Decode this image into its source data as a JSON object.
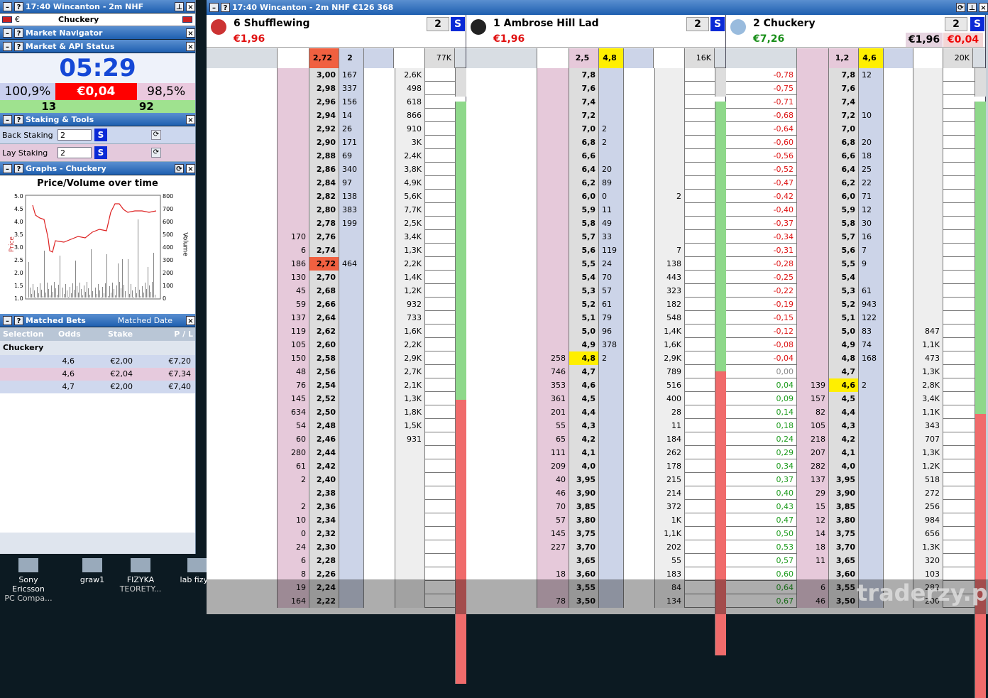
{
  "left": {
    "header": {
      "title": "17:40  Wincanton - 2m NHF",
      "currency": "€",
      "selection": "Chuckery"
    },
    "navigator": {
      "title": "Market Navigator"
    },
    "status": {
      "title": "Market & API Status",
      "clock": "05:29",
      "back_pct": "100,9%",
      "spread": "€0,04",
      "lay_pct": "98,5%",
      "count_left": "13",
      "count_right": "92"
    },
    "staking": {
      "title": "Staking & Tools",
      "back_label": "Back Staking",
      "back_value": "2",
      "lay_label": "Lay Staking",
      "lay_value": "2",
      "s": "S"
    },
    "graphs": {
      "title": "Graphs - Chuckery",
      "chart_title": "Price/Volume over time",
      "ylabel": "Price",
      "y2label": "Volume",
      "yticks": [
        "5.0",
        "4.5",
        "4.0",
        "3.5",
        "3.0",
        "2.5",
        "2.0",
        "1.5",
        "1.0"
      ],
      "y2ticks": [
        "800",
        "700",
        "600",
        "500",
        "400",
        "300",
        "200",
        "100",
        "0"
      ]
    },
    "matched": {
      "title": "Matched Bets",
      "date_label": "Matched Date",
      "cols": [
        "Selection",
        "Odds",
        "Stake",
        "P / L"
      ],
      "selection": "Chuckery",
      "rows": [
        {
          "odds": "4,6",
          "stake": "€2,00",
          "pl": "€7,20"
        },
        {
          "odds": "4,6",
          "stake": "€2,04",
          "pl": "€7,34"
        },
        {
          "odds": "4,7",
          "stake": "€2,00",
          "pl": "€7,40"
        }
      ]
    }
  },
  "desktop": [
    {
      "label": "Sony Ericsson",
      "sub": "PC Compa..."
    },
    {
      "label": "graw1",
      "sub": ""
    },
    {
      "label": "FIZYKA",
      "sub": "TEORETY..."
    },
    {
      "label": "lab fizyki",
      "sub": ""
    }
  ],
  "top": {
    "title": "17:40  Wincanton - 2m NHF   €126 368"
  },
  "watermark": "traderzy.pl",
  "ladders": [
    {
      "name": "6 Shufflewing",
      "price": "€1,96",
      "stake": "2",
      "s": "S",
      "head": [
        "2,72",
        "2",
        "77K"
      ],
      "rows": [
        [
          "",
          "3,00",
          "167",
          "2,6K"
        ],
        [
          "",
          "2,98",
          "337",
          "498"
        ],
        [
          "",
          "2,96",
          "156",
          "618"
        ],
        [
          "",
          "2,94",
          "14",
          "866"
        ],
        [
          "",
          "2,92",
          "26",
          "910"
        ],
        [
          "",
          "2,90",
          "171",
          "3K"
        ],
        [
          "",
          "2,88",
          "69",
          "2,4K"
        ],
        [
          "",
          "2,86",
          "340",
          "3,8K"
        ],
        [
          "",
          "2,84",
          "97",
          "4,9K"
        ],
        [
          "",
          "2,82",
          "138",
          "5,6K"
        ],
        [
          "",
          "2,80",
          "383",
          "7,7K"
        ],
        [
          "",
          "2,78",
          "199",
          "2,5K"
        ],
        [
          "170",
          "2,76",
          "",
          "3,4K"
        ],
        [
          "6",
          "2,74",
          "",
          "1,3K"
        ],
        [
          "186",
          "2,72",
          "464",
          "2,2K"
        ],
        [
          "130",
          "2,70",
          "",
          "1,4K"
        ],
        [
          "45",
          "2,68",
          "",
          "1,2K"
        ],
        [
          "59",
          "2,66",
          "",
          "932"
        ],
        [
          "137",
          "2,64",
          "",
          "733"
        ],
        [
          "119",
          "2,62",
          "",
          "1,6K"
        ],
        [
          "105",
          "2,60",
          "",
          "2,2K"
        ],
        [
          "150",
          "2,58",
          "",
          "2,9K"
        ],
        [
          "48",
          "2,56",
          "",
          "2,7K"
        ],
        [
          "76",
          "2,54",
          "",
          "2,1K"
        ],
        [
          "145",
          "2,52",
          "",
          "1,3K"
        ],
        [
          "634",
          "2,50",
          "",
          "1,8K"
        ],
        [
          "54",
          "2,48",
          "",
          "1,5K"
        ],
        [
          "60",
          "2,46",
          "",
          "931"
        ],
        [
          "280",
          "2,44",
          "",
          ""
        ],
        [
          "61",
          "2,42",
          "",
          ""
        ],
        [
          "2",
          "2,40",
          "",
          ""
        ],
        [
          "",
          "2,38",
          "",
          ""
        ],
        [
          "2",
          "2,36",
          "",
          ""
        ],
        [
          "10",
          "2,34",
          "",
          ""
        ],
        [
          "0",
          "2,32",
          "",
          ""
        ],
        [
          "24",
          "2,30",
          "",
          ""
        ],
        [
          "6",
          "2,28",
          "",
          ""
        ],
        [
          "8",
          "2,26",
          "",
          ""
        ],
        [
          "19",
          "2,24",
          "",
          ""
        ],
        [
          "164",
          "2,22",
          "",
          ""
        ]
      ]
    },
    {
      "name": "1 Ambrose Hill Lad",
      "price": "€1,96",
      "stake": "2",
      "s": "S",
      "head": [
        "2,5",
        "4,8",
        "16K"
      ],
      "rows": [
        [
          "",
          "7,8",
          "",
          ""
        ],
        [
          "",
          "7,6",
          "",
          ""
        ],
        [
          "",
          "7,4",
          "",
          ""
        ],
        [
          "",
          "7,2",
          "",
          ""
        ],
        [
          "",
          "7,0",
          "2",
          ""
        ],
        [
          "",
          "6,8",
          "2",
          ""
        ],
        [
          "",
          "6,6",
          "",
          ""
        ],
        [
          "",
          "6,4",
          "20",
          ""
        ],
        [
          "",
          "6,2",
          "89",
          ""
        ],
        [
          "",
          "6,0",
          "0",
          "2"
        ],
        [
          "",
          "5,9",
          "11",
          ""
        ],
        [
          "",
          "5,8",
          "49",
          ""
        ],
        [
          "",
          "5,7",
          "33",
          ""
        ],
        [
          "",
          "5,6",
          "119",
          "7"
        ],
        [
          "",
          "5,5",
          "24",
          "138"
        ],
        [
          "",
          "5,4",
          "70",
          "443"
        ],
        [
          "",
          "5,3",
          "57",
          "323"
        ],
        [
          "",
          "5,2",
          "61",
          "182"
        ],
        [
          "",
          "5,1",
          "79",
          "548"
        ],
        [
          "",
          "5,0",
          "96",
          "1,4K"
        ],
        [
          "",
          "4,9",
          "378",
          "1,6K"
        ],
        [
          "258",
          "4,8",
          "2",
          "2,9K"
        ],
        [
          "746",
          "4,7",
          "",
          "789"
        ],
        [
          "353",
          "4,6",
          "",
          "516"
        ],
        [
          "361",
          "4,5",
          "",
          "400"
        ],
        [
          "201",
          "4,4",
          "",
          "28"
        ],
        [
          "55",
          "4,3",
          "",
          "11"
        ],
        [
          "65",
          "4,2",
          "",
          "184"
        ],
        [
          "111",
          "4,1",
          "",
          "262"
        ],
        [
          "209",
          "4,0",
          "",
          "178"
        ],
        [
          "40",
          "3,95",
          "",
          "215"
        ],
        [
          "46",
          "3,90",
          "",
          "214"
        ],
        [
          "70",
          "3,85",
          "",
          "372"
        ],
        [
          "57",
          "3,80",
          "",
          "1K"
        ],
        [
          "145",
          "3,75",
          "",
          "1,1K"
        ],
        [
          "227",
          "3,70",
          "",
          "202"
        ],
        [
          "",
          "3,65",
          "",
          "55"
        ],
        [
          "18",
          "3,60",
          "",
          "183"
        ],
        [
          "",
          "3,55",
          "",
          "84"
        ],
        [
          "78",
          "3,50",
          "",
          "134"
        ]
      ]
    },
    {
      "name": "2 Chuckery",
      "price": "€7,26",
      "stake": "2",
      "s": "S",
      "pl": "€1,96",
      "pl2": "€0,04",
      "head": [
        "1,2",
        "4,6",
        "20K"
      ],
      "rows": [
        [
          "-0,78",
          "",
          "7,8",
          "12",
          ""
        ],
        [
          "-0,75",
          "",
          "7,6",
          "",
          ""
        ],
        [
          "-0,71",
          "",
          "7,4",
          "",
          ""
        ],
        [
          "-0,68",
          "",
          "7,2",
          "10",
          ""
        ],
        [
          "-0,64",
          "",
          "7,0",
          "",
          ""
        ],
        [
          "-0,60",
          "",
          "6,8",
          "20",
          ""
        ],
        [
          "-0,56",
          "",
          "6,6",
          "18",
          ""
        ],
        [
          "-0,52",
          "",
          "6,4",
          "25",
          ""
        ],
        [
          "-0,47",
          "",
          "6,2",
          "22",
          ""
        ],
        [
          "-0,42",
          "",
          "6,0",
          "71",
          ""
        ],
        [
          "-0,40",
          "",
          "5,9",
          "12",
          ""
        ],
        [
          "-0,37",
          "",
          "5,8",
          "30",
          ""
        ],
        [
          "-0,34",
          "",
          "5,7",
          "16",
          ""
        ],
        [
          "-0,31",
          "",
          "5,6",
          "7",
          ""
        ],
        [
          "-0,28",
          "",
          "5,5",
          "9",
          ""
        ],
        [
          "-0,25",
          "",
          "5,4",
          "",
          ""
        ],
        [
          "-0,22",
          "",
          "5,3",
          "61",
          ""
        ],
        [
          "-0,19",
          "",
          "5,2",
          "943",
          ""
        ],
        [
          "-0,15",
          "",
          "5,1",
          "122",
          ""
        ],
        [
          "-0,12",
          "",
          "5,0",
          "83",
          "847"
        ],
        [
          "-0,08",
          "",
          "4,9",
          "74",
          "1,1K"
        ],
        [
          "-0,04",
          "",
          "4,8",
          "168",
          "473"
        ],
        [
          "0,00",
          "",
          "4,7",
          "",
          "1,3K"
        ],
        [
          "0,04",
          "139",
          "4,6",
          "2",
          "2,8K"
        ],
        [
          "0,09",
          "157",
          "4,5",
          "",
          "3,4K"
        ],
        [
          "0,14",
          "82",
          "4,4",
          "",
          "1,1K"
        ],
        [
          "0,18",
          "105",
          "4,3",
          "",
          "343"
        ],
        [
          "0,24",
          "218",
          "4,2",
          "",
          "707"
        ],
        [
          "0,29",
          "207",
          "4,1",
          "",
          "1,3K"
        ],
        [
          "0,34",
          "282",
          "4,0",
          "",
          "1,2K"
        ],
        [
          "0,37",
          "137",
          "3,95",
          "",
          "518"
        ],
        [
          "0,40",
          "29",
          "3,90",
          "",
          "272"
        ],
        [
          "0,43",
          "15",
          "3,85",
          "",
          "256"
        ],
        [
          "0,47",
          "12",
          "3,80",
          "",
          "984"
        ],
        [
          "0,50",
          "14",
          "3,75",
          "",
          "656"
        ],
        [
          "0,53",
          "18",
          "3,70",
          "",
          "1,3K"
        ],
        [
          "0,57",
          "11",
          "3,65",
          "",
          "320"
        ],
        [
          "0,60",
          "",
          "3,60",
          "",
          "103"
        ],
        [
          "0,64",
          "6",
          "3,55",
          "",
          "282"
        ],
        [
          "0,67",
          "46",
          "3,50",
          "",
          "200"
        ]
      ]
    }
  ]
}
